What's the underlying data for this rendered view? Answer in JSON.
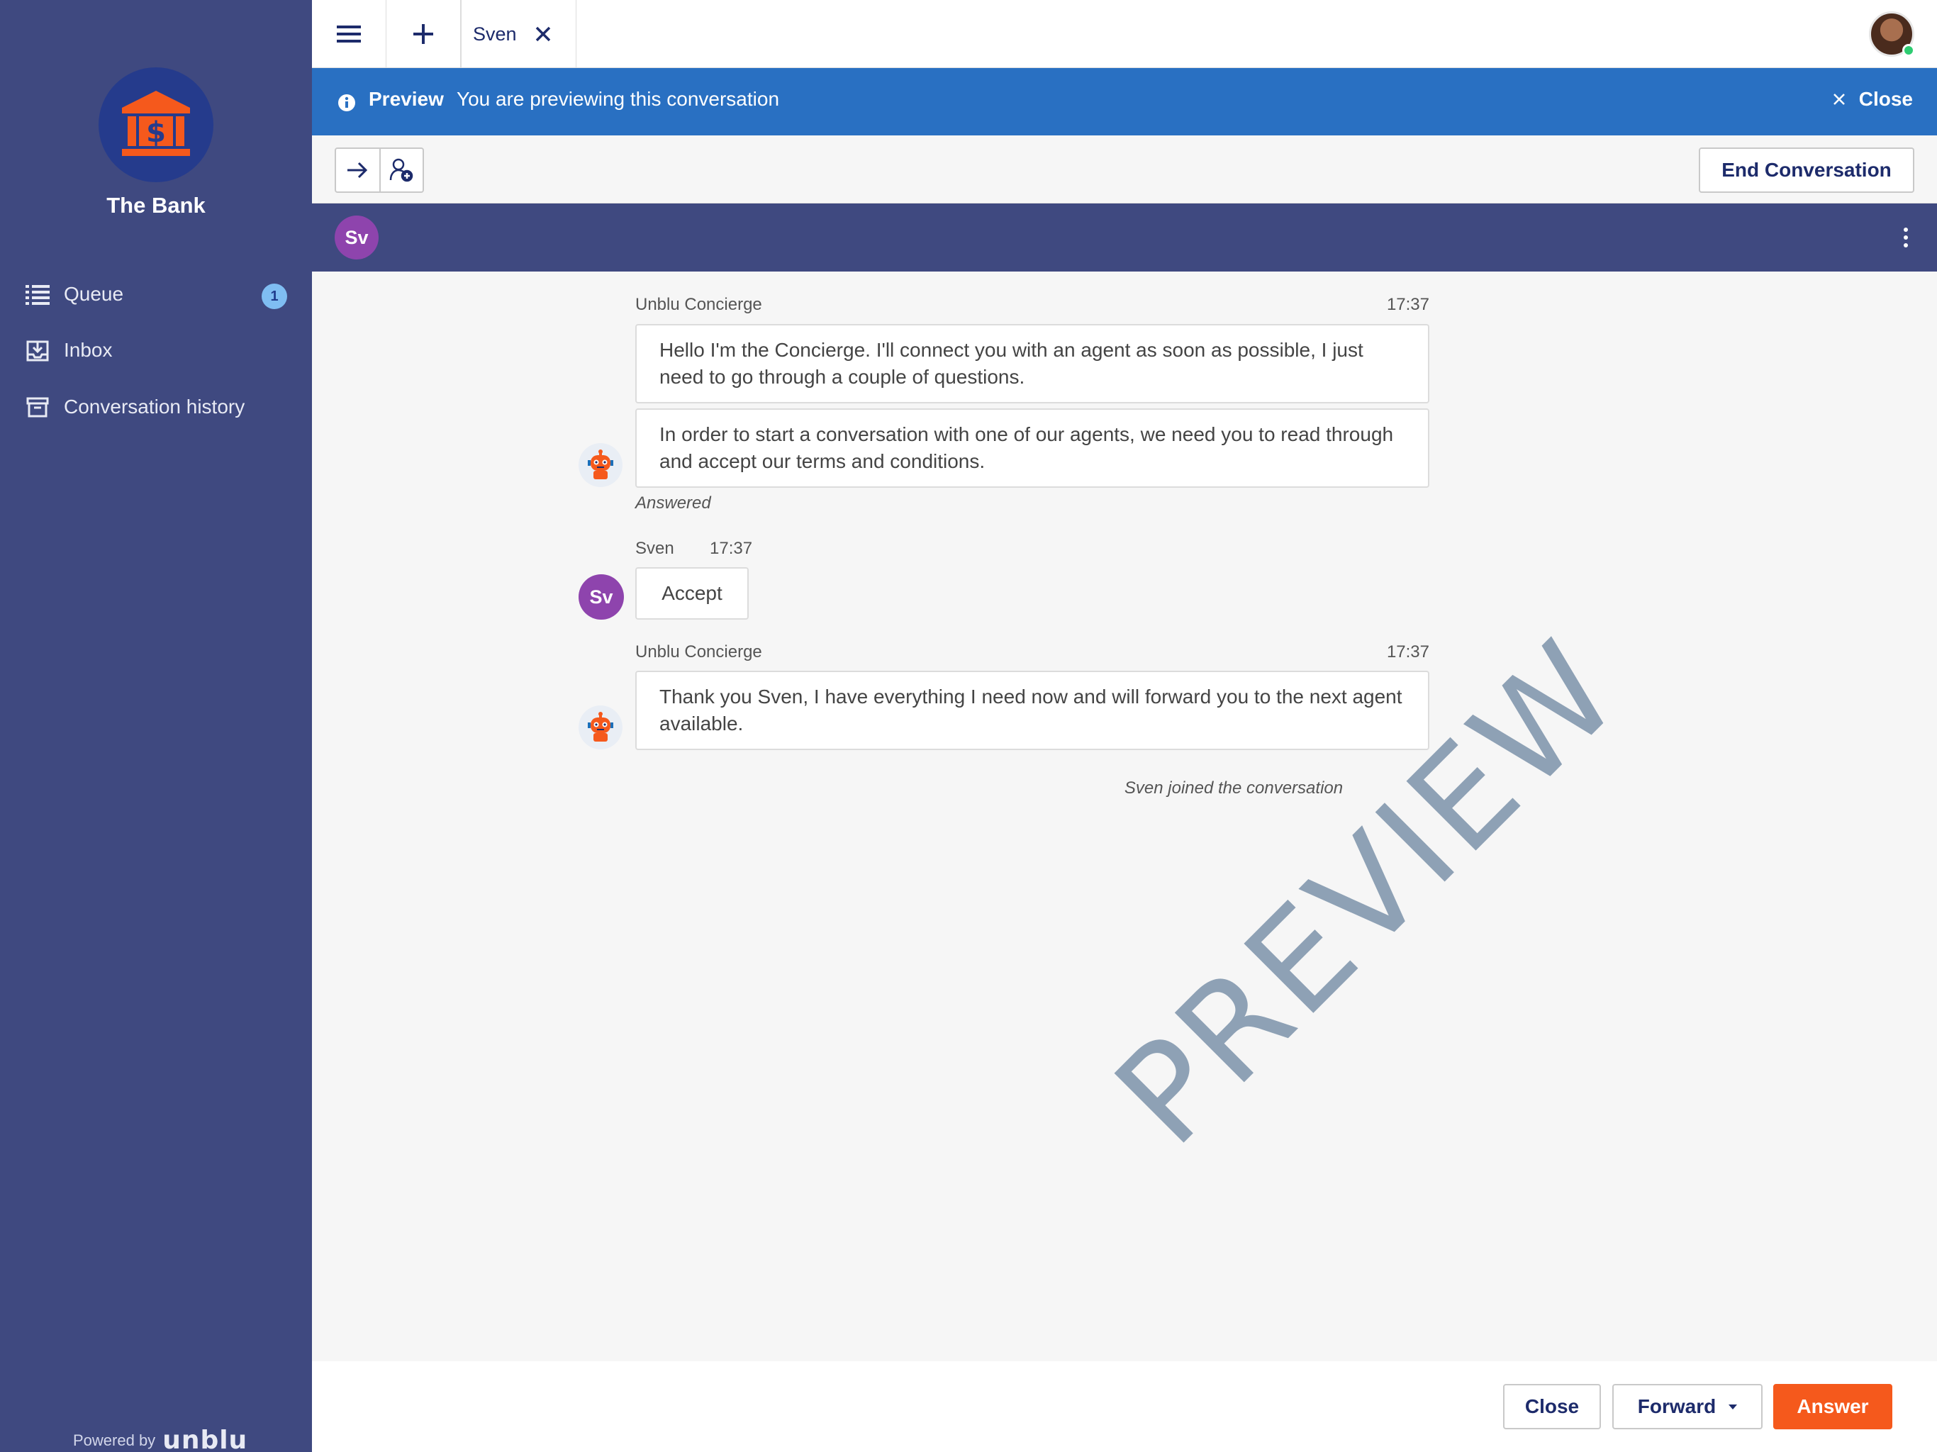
{
  "app": {
    "brand_name": "The Bank"
  },
  "colors": {
    "sidebar": "#3f4980",
    "banner": "#2970c2",
    "accent": "#f5591c",
    "avatar": "#8e44ad"
  },
  "sidebar": {
    "items": [
      {
        "label": "Queue",
        "icon": "list-icon",
        "badge": "1"
      },
      {
        "label": "Inbox",
        "icon": "inbox-icon"
      },
      {
        "label": "Conversation history",
        "icon": "archive-icon"
      }
    ],
    "powered_by": "Powered by",
    "powered_logo": "unblu"
  },
  "topbar": {
    "tabs": [
      {
        "label": "Sven"
      }
    ]
  },
  "banner": {
    "title": "Preview",
    "text": "You are previewing this conversation",
    "close_label": "Close"
  },
  "toolbar": {
    "end_label": "End Conversation"
  },
  "participants": {
    "initials": "Sv"
  },
  "conversation": {
    "block1": {
      "sender": "Unblu Concierge",
      "time": "17:37",
      "messages": [
        "Hello I'm the Concierge. I'll connect you with an agent as soon as possible, I just need to go through a couple of questions.",
        "In order to start a conversation with one of our agents, we need you to read through and accept our terms and conditions."
      ],
      "status": "Answered"
    },
    "block2": {
      "sender": "Sven",
      "time": "17:37",
      "initials": "Sv",
      "message": "Accept"
    },
    "block3": {
      "sender": "Unblu Concierge",
      "time": "17:37",
      "message": "Thank you Sven, I have everything I need now and will forward you to the next agent available."
    },
    "system_note": "Sven joined the conversation",
    "watermark": "PREVIEW"
  },
  "footer": {
    "close_label": "Close",
    "forward_label": "Forward",
    "answer_label": "Answer"
  }
}
